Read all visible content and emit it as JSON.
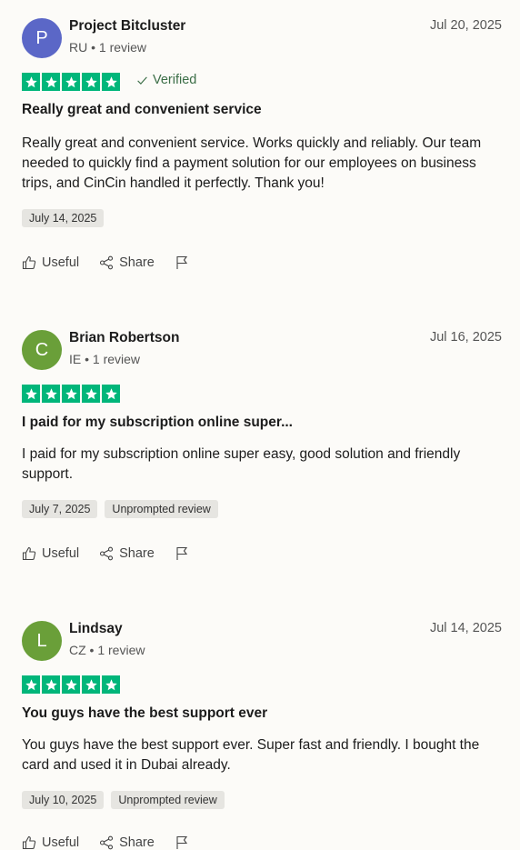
{
  "reviews": [
    {
      "initial": "P",
      "avatar_color": "#5b67c7",
      "name": "Project Bitcluster",
      "meta": "RU • 1 review",
      "date": "Jul 20, 2025",
      "rating": 5,
      "verified_label": "Verified",
      "title": "Really great and convenient service",
      "body": "Really great and convenient service. Works quickly and reliably. Our team needed to quickly find a payment solution for our employees on business trips, and CinCin handled it perfectly. Thank you!",
      "tags": [
        "July 14, 2025"
      ]
    },
    {
      "initial": "C",
      "avatar_color": "#6a9f39",
      "name": "Brian Robertson",
      "meta": "IE • 1 review",
      "date": "Jul 16, 2025",
      "rating": 5,
      "title": "I paid for my subscription online super...",
      "body": "I paid for my subscription online super easy, good solution and friendly support.",
      "tags": [
        "July 7, 2025",
        "Unprompted review"
      ]
    },
    {
      "initial": "L",
      "avatar_color": "#6a9f39",
      "name": "Lindsay",
      "meta": "CZ • 1 review",
      "date": "Jul 14, 2025",
      "rating": 5,
      "title": "You guys have the best support ever",
      "body": "You guys have the best support ever. Super fast and friendly. I bought the card and used it in Dubai already.",
      "tags": [
        "July 10, 2025",
        "Unprompted review"
      ]
    }
  ],
  "actions": {
    "useful_label": "Useful",
    "share_label": "Share"
  },
  "colors": {
    "star_green": "#00b67a",
    "verified_green": "#3b6e47"
  },
  "icons": [
    "star-icon",
    "check-icon",
    "thumbs-up-icon",
    "share-icon",
    "flag-icon"
  ]
}
